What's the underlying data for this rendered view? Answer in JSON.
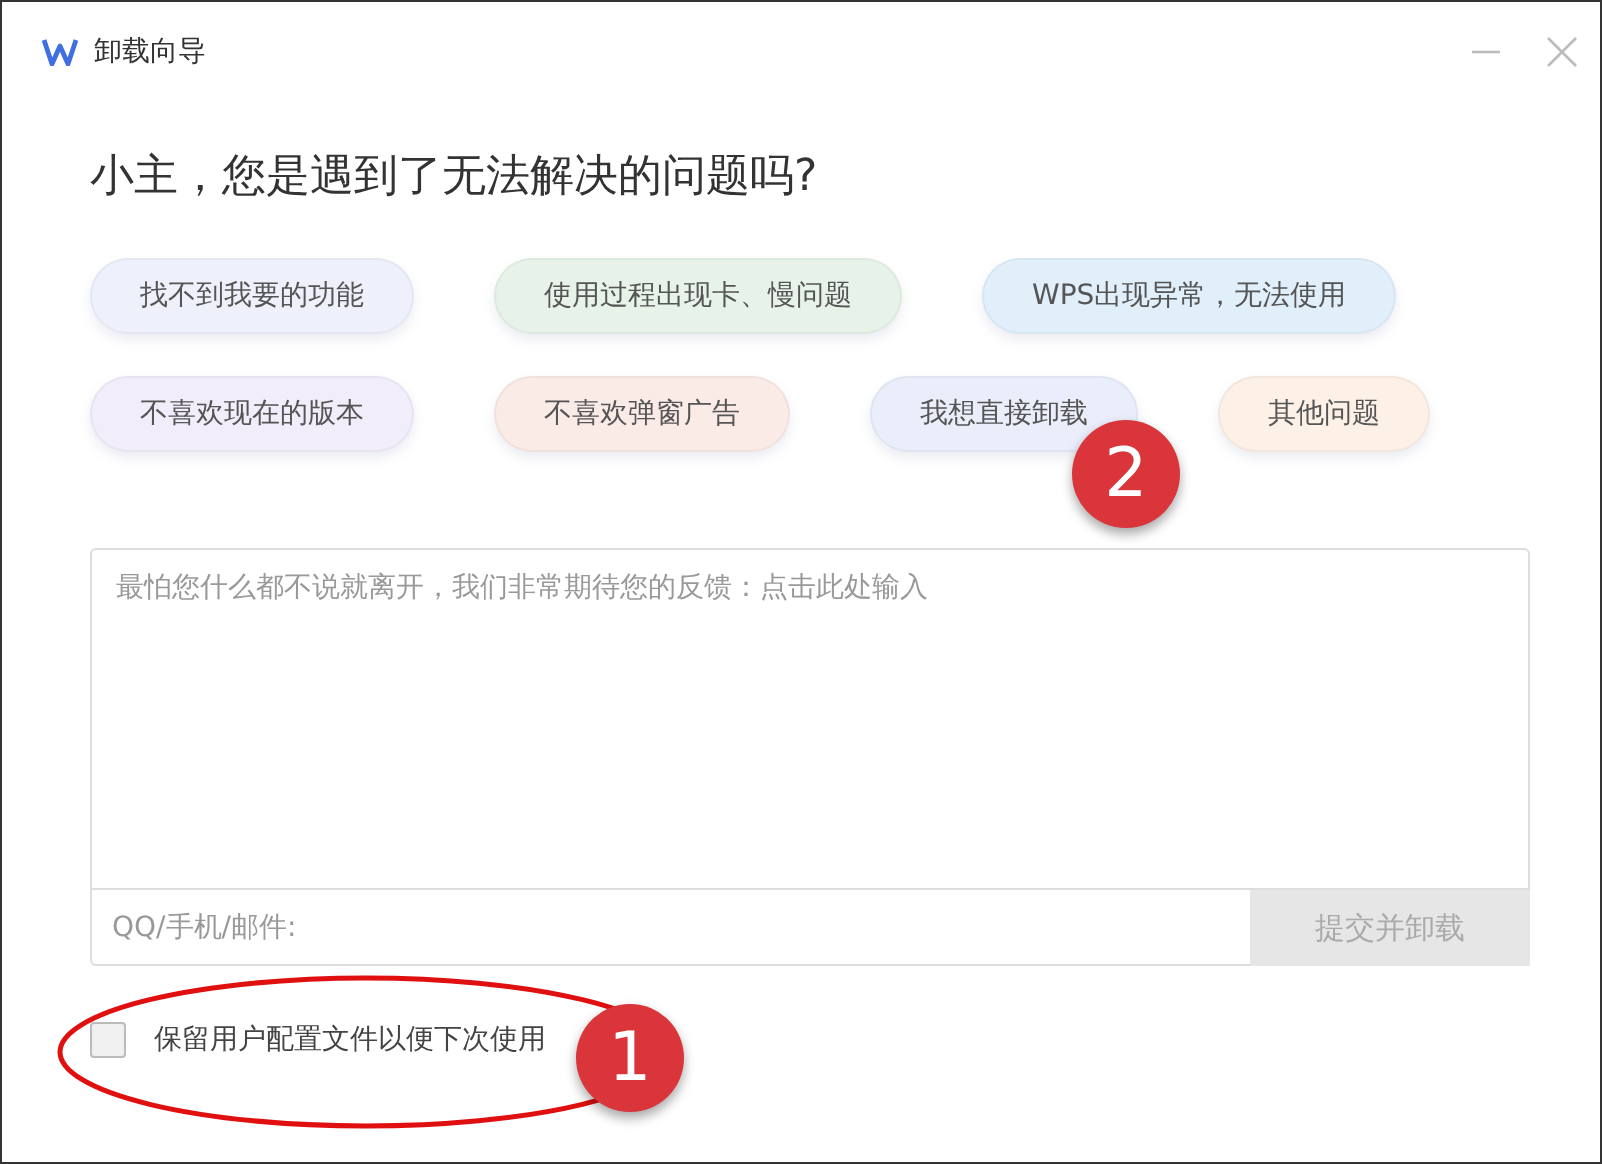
{
  "window": {
    "title": "卸载向导"
  },
  "heading": "小主，您是遇到了无法解决的问题吗?",
  "reasons": [
    [
      {
        "label": "找不到我要的功能",
        "color": "#eef1fc"
      },
      {
        "label": "使用过程出现卡、慢问题",
        "color": "#e7f3e9"
      },
      {
        "label": "WPS出现异常，无法使用",
        "color": "#e1effb"
      }
    ],
    [
      {
        "label": "不喜欢现在的版本",
        "color": "#f2edfa"
      },
      {
        "label": "不喜欢弹窗广告",
        "color": "#fbebe7"
      },
      {
        "label": "我想直接卸载",
        "color": "#eaedfa"
      },
      {
        "label": "其他问题",
        "color": "#fcf0e7"
      }
    ]
  ],
  "feedback": {
    "placeholder": "最怕您什么都不说就离开，我们非常期待您的反馈：点击此处输入"
  },
  "contact": {
    "placeholder": "QQ/手机/邮件:"
  },
  "submit_button": {
    "label": "提交并卸载",
    "disabled": true
  },
  "keep_config": {
    "label": "保留用户配置文件以便下次使用",
    "checked": false
  },
  "annotations": [
    {
      "label": "1"
    },
    {
      "label": "2"
    }
  ]
}
